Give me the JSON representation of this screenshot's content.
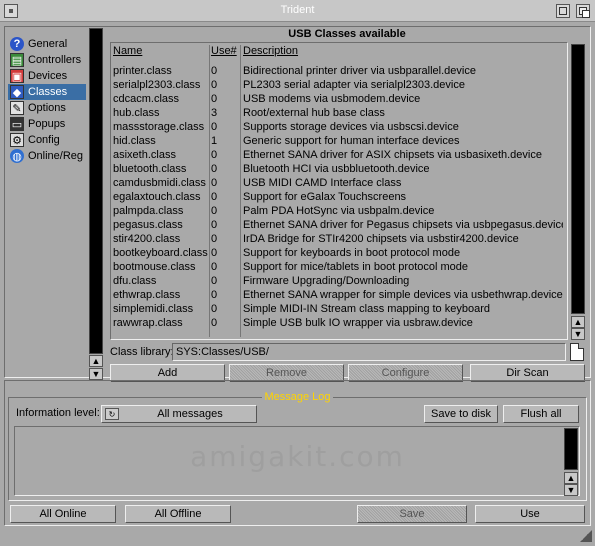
{
  "window": {
    "title": "Trident"
  },
  "nav": {
    "items": [
      {
        "label": "General",
        "icon": "help-icon"
      },
      {
        "label": "Controllers",
        "icon": "controller-icon"
      },
      {
        "label": "Devices",
        "icon": "device-icon"
      },
      {
        "label": "Classes",
        "icon": "cube-icon",
        "selected": true
      },
      {
        "label": "Options",
        "icon": "options-icon"
      },
      {
        "label": "Popups",
        "icon": "popup-icon"
      },
      {
        "label": "Config",
        "icon": "config-icon"
      },
      {
        "label": "Online/Reg",
        "icon": "globe-icon"
      }
    ]
  },
  "classes": {
    "title": "USB Classes available",
    "columns": {
      "name": "Name",
      "use": "Use#",
      "description": "Description"
    },
    "rows": [
      {
        "name": "printer.class",
        "use": "0",
        "description": "Bidirectional printer driver via usbparallel.device"
      },
      {
        "name": "serialpl2303.class",
        "use": "0",
        "description": "PL2303 serial adapter via serialpl2303.device"
      },
      {
        "name": "cdcacm.class",
        "use": "0",
        "description": "USB modems via usbmodem.device"
      },
      {
        "name": "hub.class",
        "use": "3",
        "description": "Root/external hub base class"
      },
      {
        "name": "massstorage.class",
        "use": "0",
        "description": "Supports storage devices via usbscsi.device"
      },
      {
        "name": "hid.class",
        "use": "1",
        "description": "Generic support for human interface devices"
      },
      {
        "name": "asixeth.class",
        "use": "0",
        "description": "Ethernet SANA driver for ASIX chipsets via usbasixeth.device"
      },
      {
        "name": "bluetooth.class",
        "use": "0",
        "description": "Bluetooth HCI via usbbluetooth.device"
      },
      {
        "name": "camdusbmidi.class",
        "use": "0",
        "description": "USB MIDI CAMD Interface class"
      },
      {
        "name": "egalaxtouch.class",
        "use": "0",
        "description": "Support for eGalax Touchscreens"
      },
      {
        "name": "palmpda.class",
        "use": "0",
        "description": "Palm PDA HotSync via usbpalm.device"
      },
      {
        "name": "pegasus.class",
        "use": "0",
        "description": "Ethernet SANA driver for Pegasus chipsets via usbpegasus.device"
      },
      {
        "name": "stir4200.class",
        "use": "0",
        "description": "IrDA Bridge for STIr4200 chipsets via usbstir4200.device"
      },
      {
        "name": "bootkeyboard.class",
        "use": "0",
        "description": "Support for keyboards in boot protocol mode"
      },
      {
        "name": "bootmouse.class",
        "use": "0",
        "description": "Support for mice/tablets in boot protocol mode"
      },
      {
        "name": "dfu.class",
        "use": "0",
        "description": "Firmware Upgrading/Downloading"
      },
      {
        "name": "ethwrap.class",
        "use": "0",
        "description": "Ethernet SANA wrapper for simple devices via usbethwrap.device"
      },
      {
        "name": "simplemidi.class",
        "use": "0",
        "description": "Simple MIDI-IN Stream class mapping to keyboard"
      },
      {
        "name": "rawwrap.class",
        "use": "0",
        "description": "Simple USB bulk IO wrapper via usbraw.device"
      }
    ],
    "library_label": "Class library:",
    "library_value": "SYS:Classes/USB/",
    "buttons": {
      "add": "Add",
      "remove": "Remove",
      "configure": "Configure",
      "dirscan": "Dir Scan"
    }
  },
  "log": {
    "title": "Message Log",
    "info_label": "Information level:",
    "info_value": "All messages",
    "save_to_disk": "Save to disk",
    "flush_all": "Flush all",
    "watermark": "amigakit.com"
  },
  "footer": {
    "all_online": "All Online",
    "all_offline": "All Offline",
    "save": "Save",
    "use": "Use"
  },
  "colors": {
    "background": "#a9a9a9",
    "selection": "#3a6ea5",
    "log_title": "#ffd400"
  }
}
